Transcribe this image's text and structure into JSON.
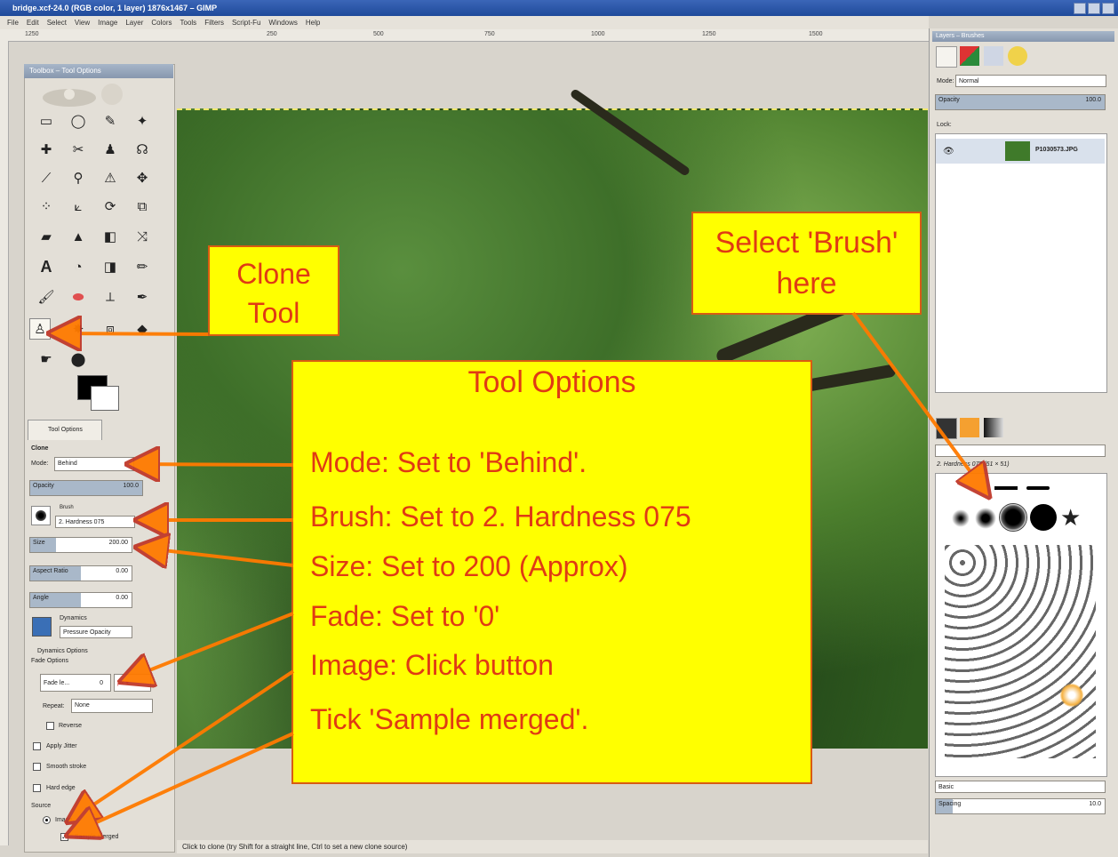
{
  "window": {
    "title": "bridge.xcf-24.0 (RGB color, 1 layer) 1876x1467 – GIMP"
  },
  "menubar": [
    "File",
    "Edit",
    "Select",
    "View",
    "Image",
    "Layer",
    "Colors",
    "Tools",
    "Filters",
    "Script-Fu",
    "Windows",
    "Help"
  ],
  "ruler": {
    "ticks": [
      "1250",
      "250",
      "500",
      "750",
      "1000",
      "1250",
      "1500"
    ]
  },
  "toolbox": {
    "title": "Toolbox – Tool Options"
  },
  "tool_options": {
    "tab_label": "Tool Options",
    "tool_name": "Clone",
    "mode_label": "Mode:",
    "mode_value": "Behind",
    "opacity_label": "Opacity",
    "opacity_value": "100.0",
    "brush_label": "Brush",
    "brush_value": "2. Hardness 075",
    "size_label": "Size",
    "size_value": "200.00",
    "aspect_label": "Aspect Ratio",
    "aspect_value": "0.00",
    "angle_label": "Angle",
    "angle_value": "0.00",
    "dynamics_label": "Dynamics",
    "dynamics_value": "Pressure Opacity",
    "dynamics_options": "Dynamics Options",
    "fade_options": "Fade Options",
    "fade_value": "Fade le...",
    "fade_number": "0",
    "repeat_label": "Repeat:",
    "repeat_value": "None",
    "reverse": "Reverse",
    "apply_jitter": "Apply Jitter",
    "smooth_stroke": "Smooth stroke",
    "hard_edge": "Hard edge",
    "source_label": "Source",
    "source_image": "Image",
    "sample_merged": "Sample merged"
  },
  "statusbar": {
    "text": "Click to clone (try Shift for a straight line, Ctrl to set a new clone source)"
  },
  "dock": {
    "title": "Layers – Brushes",
    "mode_label": "Mode:",
    "mode_value": "Normal",
    "opacity_label": "Opacity",
    "opacity_value": "100.0",
    "lock_label": "Lock:",
    "layer_name": "P1030573.JPG",
    "brush_header": "2. Hardness 075 (51 × 51)",
    "brush_tag": "Basic",
    "spacing_label": "Spacing",
    "spacing_value": "10.0"
  },
  "callouts": {
    "clone_tool": [
      "Clone",
      "Tool"
    ],
    "select_brush": [
      "Select 'Brush'",
      "here"
    ],
    "tool_options": {
      "heading": "Tool Options",
      "lines": [
        "Mode: Set to 'Behind'.",
        "Brush: Set to 2. Hardness 075",
        "Size: Set to 200 (Approx)",
        "Fade: Set to '0'",
        "Image: Click button",
        "Tick 'Sample merged'."
      ]
    }
  },
  "colors": {
    "callout_fill": "#ffff00",
    "callout_text": "#e03a14",
    "callout_border": "#d85c12",
    "arrow": "#ff7a00"
  }
}
